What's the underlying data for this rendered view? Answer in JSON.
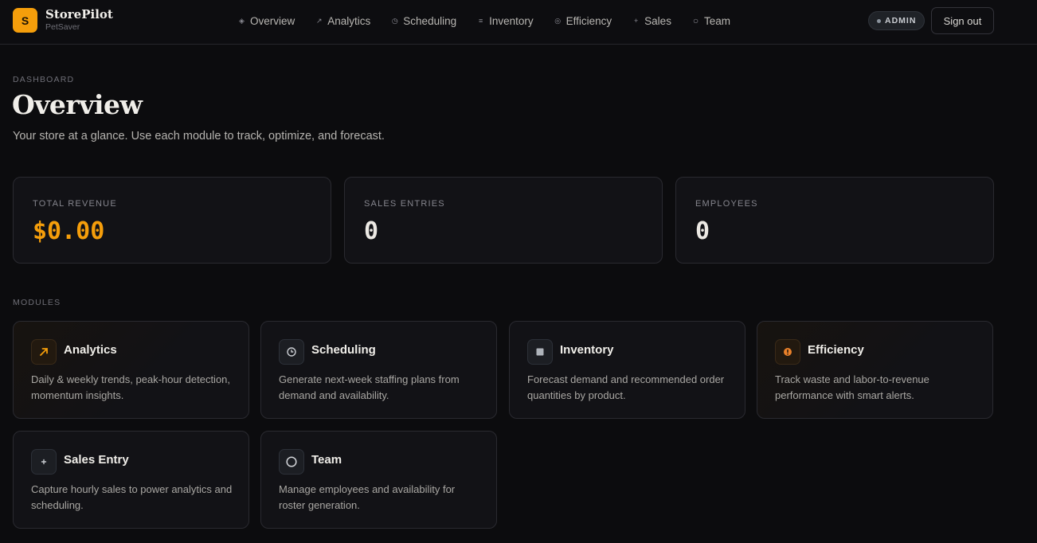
{
  "brand": {
    "logo_letter": "S",
    "name": "StorePilot",
    "store": "PetSaver"
  },
  "nav": [
    {
      "label": "Overview",
      "icon": "◈",
      "icon_name": "diamond-icon"
    },
    {
      "label": "Analytics",
      "icon": "↗",
      "icon_name": "trend-arrow-icon"
    },
    {
      "label": "Scheduling",
      "icon": "◷",
      "icon_name": "clock-icon"
    },
    {
      "label": "Inventory",
      "icon": "≡",
      "icon_name": "list-icon"
    },
    {
      "label": "Efficiency",
      "icon": "◎",
      "icon_name": "target-icon"
    },
    {
      "label": "Sales",
      "icon": "+",
      "icon_name": "plus-icon"
    },
    {
      "label": "Team",
      "icon": "○",
      "icon_name": "circle-icon"
    }
  ],
  "header": {
    "role_badge": "ADMIN",
    "signout_label": "Sign out"
  },
  "page": {
    "eyebrow": "DASHBOARD",
    "title": "Overview",
    "description": "Your store at a glance. Use each module to track, optimize, and forecast."
  },
  "stats": [
    {
      "label": "TOTAL REVENUE",
      "value": "$0.00"
    },
    {
      "label": "SALES ENTRIES",
      "value": "0"
    },
    {
      "label": "EMPLOYEES",
      "value": "0"
    }
  ],
  "modules_heading": "MODULES",
  "modules": [
    {
      "title": "Analytics",
      "description": "Daily & weekly trends, peak-hour detection, momentum insights.",
      "icon_name": "trend-arrow-icon"
    },
    {
      "title": "Scheduling",
      "description": "Generate next-week staffing plans from demand and availability.",
      "icon_name": "clock-icon"
    },
    {
      "title": "Inventory",
      "description": "Forecast demand and recommended order quantities by product.",
      "icon_name": "box-icon"
    },
    {
      "title": "Efficiency",
      "description": "Track waste and labor-to-revenue performance with smart alerts.",
      "icon_name": "gauge-icon"
    },
    {
      "title": "Sales Entry",
      "description": "Capture hourly sales to power analytics and scheduling.",
      "icon_name": "plus-icon"
    },
    {
      "title": "Team",
      "description": "Manage employees and availability for roster generation.",
      "icon_name": "circle-icon"
    }
  ],
  "colors": {
    "accent": "#f59e0b",
    "background": "#0c0c0e",
    "card": "#121216",
    "border": "#2a2a30"
  }
}
